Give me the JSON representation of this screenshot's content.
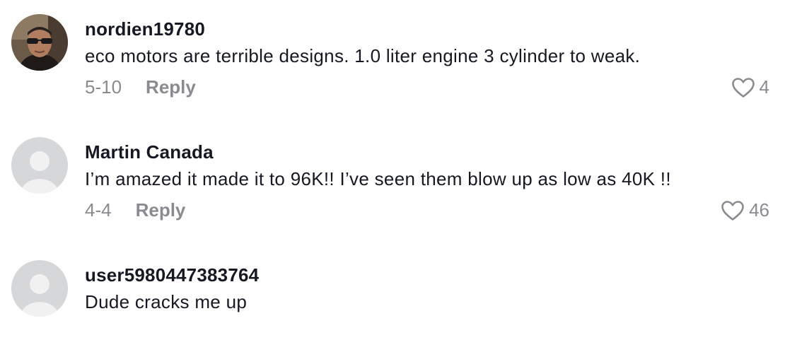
{
  "comments": [
    {
      "username": "nordien19780",
      "text": "eco motors are terrible designs. 1.0 liter engine 3 cylinder to weak.",
      "date": "5-10",
      "reply_label": "Reply",
      "likes": "4",
      "avatar": "user-photo-sunglasses"
    },
    {
      "username": "Martin Canada",
      "text": "I’m amazed it made it to 96K!! I’ve seen them blow up as low as 40K !!",
      "date": "4-4",
      "reply_label": "Reply",
      "likes": "46",
      "avatar": "default-avatar"
    },
    {
      "username": "user5980447383764",
      "text": "Dude cracks me up",
      "avatar": "default-avatar"
    }
  ],
  "colors": {
    "text": "#161823",
    "muted": "#8a8b91",
    "default_avatar_bg": "#d6d7d9",
    "default_avatar_fg": "#f1f1f2"
  },
  "icons": {
    "like": "heart-outline-icon"
  }
}
